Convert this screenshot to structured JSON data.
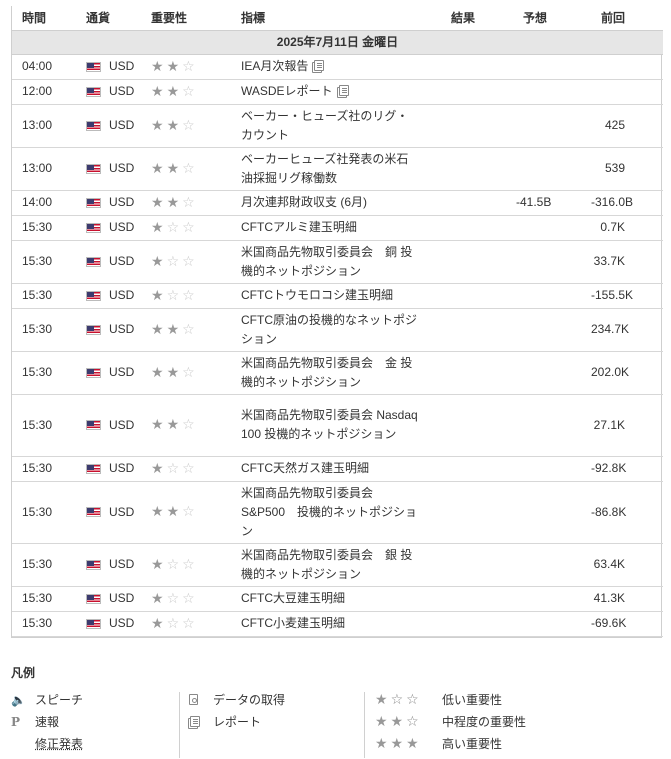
{
  "columns": {
    "time": "時間",
    "currency": "通貨",
    "importance": "重要性",
    "indicator": "指標",
    "actual": "結果",
    "forecast": "予想",
    "previous": "前回"
  },
  "date_header": "2025年7月11日 金曜日",
  "icons": {
    "flag": "us-flag-icon",
    "report": "report-icon",
    "star_filled": "★",
    "star_empty": "☆"
  },
  "events": [
    {
      "time": "04:00",
      "currency": "USD",
      "stars": 2,
      "indicator": "IEA月次報告",
      "report": true,
      "actual": "",
      "forecast": "",
      "previous": ""
    },
    {
      "time": "12:00",
      "currency": "USD",
      "stars": 2,
      "indicator": "WASDEレポート",
      "report": true,
      "actual": "",
      "forecast": "",
      "previous": ""
    },
    {
      "time": "13:00",
      "currency": "USD",
      "stars": 2,
      "indicator": "ベーカー・ヒューズ社のリグ・カウント",
      "report": false,
      "actual": "",
      "forecast": "",
      "previous": "425"
    },
    {
      "time": "13:00",
      "currency": "USD",
      "stars": 2,
      "indicator": "ベーカーヒューズ社発表の米石油採掘リグ稼働数",
      "report": false,
      "actual": "",
      "forecast": "",
      "previous": "539"
    },
    {
      "time": "14:00",
      "currency": "USD",
      "stars": 2,
      "indicator": "月次連邦財政収支 (6月)",
      "report": false,
      "actual": "",
      "forecast": "-41.5B",
      "previous": "-316.0B"
    },
    {
      "time": "15:30",
      "currency": "USD",
      "stars": 1,
      "indicator": "CFTCアルミ建玉明細",
      "report": false,
      "actual": "",
      "forecast": "",
      "previous": "0.7K"
    },
    {
      "time": "15:30",
      "currency": "USD",
      "stars": 1,
      "indicator": "米国商品先物取引委員会　銅 投機的ネットポジション",
      "report": false,
      "actual": "",
      "forecast": "",
      "previous": "33.7K"
    },
    {
      "time": "15:30",
      "currency": "USD",
      "stars": 1,
      "indicator": "CFTCトウモロコシ建玉明細",
      "report": false,
      "actual": "",
      "forecast": "",
      "previous": "-155.5K"
    },
    {
      "time": "15:30",
      "currency": "USD",
      "stars": 2,
      "indicator": "CFTC原油の投機的なネットポジション",
      "report": false,
      "actual": "",
      "forecast": "",
      "previous": "234.7K"
    },
    {
      "time": "15:30",
      "currency": "USD",
      "stars": 2,
      "indicator": "米国商品先物取引委員会　金 投機的ネットポジション",
      "report": false,
      "actual": "",
      "forecast": "",
      "previous": "202.0K"
    },
    {
      "time": "15:30",
      "currency": "USD",
      "stars": 2,
      "indicator": "米国商品先物取引委員会 Nasdaq 100 投機的ネットポジション",
      "report": false,
      "actual": "",
      "forecast": "",
      "previous": "27.1K"
    },
    {
      "time": "15:30",
      "currency": "USD",
      "stars": 1,
      "indicator": "CFTC天然ガス建玉明細",
      "report": false,
      "actual": "",
      "forecast": "",
      "previous": "-92.8K"
    },
    {
      "time": "15:30",
      "currency": "USD",
      "stars": 2,
      "indicator": "米国商品先物取引委員会 S&P500　投機的ネットポジション",
      "report": false,
      "actual": "",
      "forecast": "",
      "previous": "-86.8K"
    },
    {
      "time": "15:30",
      "currency": "USD",
      "stars": 1,
      "indicator": "米国商品先物取引委員会　銀 投機的ネットポジション",
      "report": false,
      "actual": "",
      "forecast": "",
      "previous": "63.4K"
    },
    {
      "time": "15:30",
      "currency": "USD",
      "stars": 1,
      "indicator": "CFTC大豆建玉明細",
      "report": false,
      "actual": "",
      "forecast": "",
      "previous": "41.3K"
    },
    {
      "time": "15:30",
      "currency": "USD",
      "stars": 1,
      "indicator": "CFTC小麦建玉明細",
      "report": false,
      "actual": "",
      "forecast": "",
      "previous": "-69.6K"
    }
  ],
  "legend": {
    "title": "凡例",
    "speech": "スピーチ",
    "preliminary": "速報",
    "revised": "修正発表",
    "data_acquisition": "データの取得",
    "report": "レポート",
    "low": "低い重要性",
    "medium": "中程度の重要性",
    "high": "高い重要性"
  }
}
